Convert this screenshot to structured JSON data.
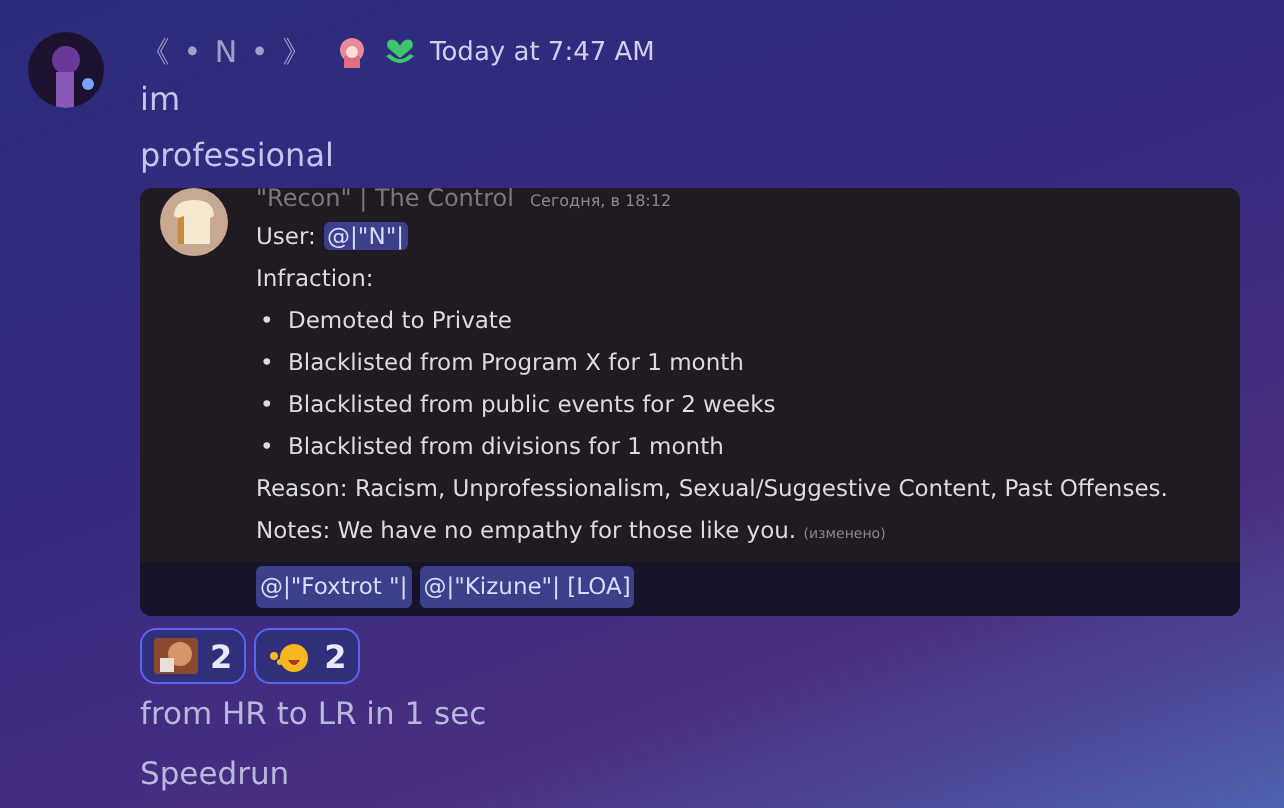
{
  "message": {
    "author": "《 • N • 》",
    "timestamp": "Today at 7:47 AM",
    "lines": [
      "im",
      "professional"
    ]
  },
  "attachment": {
    "kind": "picture",
    "author": "\"Recon\" | The Control",
    "timestamp": "Сегодня, в 18:12",
    "user_label": "User:",
    "user_mention": "@|\"N\"|",
    "infraction": "Infraction:",
    "bullets": [
      {
        "marker": "•",
        "text": "Demoted to Private"
      },
      {
        "marker": "•",
        "text": "Blacklisted from Program X for 1 month"
      },
      {
        "marker": "•",
        "text": "Blacklisted from public events for 2 weeks"
      },
      {
        "marker": "•",
        "text": "Blacklisted from divisions for 1 month"
      }
    ],
    "reason": "Reason: Racism, Unprofessionalism, Sexual/Suggestive Content, Past Offenses.",
    "notes": "Notes: We have no empathy for those like you.",
    "edited": "(изменено)",
    "mentions": [
      {
        "text": "@|\"Foxtrot \"|"
      },
      {
        "text": "@|\"Kizune\"| [LOA]"
      }
    ]
  },
  "reactions": [
    {
      "count": "2",
      "selected": true
    },
    {
      "count": "2",
      "selected": true
    }
  ],
  "followups": [
    "from HR to LR in 1 sec",
    "Speedrun"
  ]
}
